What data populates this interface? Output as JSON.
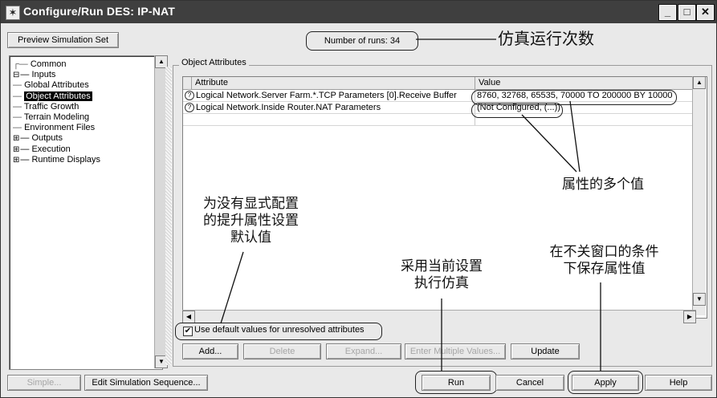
{
  "window": {
    "title": "Configure/Run DES: IP-NAT",
    "icon": "star-app-icon",
    "controls": [
      "minimize-icon",
      "maximize-icon",
      "close-icon"
    ]
  },
  "toolbar": {
    "preview_button": "Preview Simulation Set",
    "runs_label": "Number of runs: 34"
  },
  "tree": {
    "items": [
      {
        "label": "Common",
        "expander": ""
      },
      {
        "label": "Inputs",
        "expander": "⊟"
      },
      {
        "label": "Global Attributes",
        "expander": ""
      },
      {
        "label": "Object Attributes",
        "expander": "",
        "selected": true
      },
      {
        "label": "Traffic Growth",
        "expander": ""
      },
      {
        "label": "Terrain Modeling",
        "expander": ""
      },
      {
        "label": "Environment Files",
        "expander": ""
      },
      {
        "label": "Outputs",
        "expander": "⊞"
      },
      {
        "label": "Execution",
        "expander": "⊞"
      },
      {
        "label": "Runtime Displays",
        "expander": "⊞"
      }
    ]
  },
  "attributes": {
    "group_title": "Object Attributes",
    "columns": [
      "Attribute",
      "Value"
    ],
    "rows": [
      {
        "attribute": "Logical Network.Server Farm.*.TCP Parameters [0].Receive Buffer",
        "value": "8760, 32768, 65535, 70000 TO 200000 BY 10000"
      },
      {
        "attribute": "Logical Network.Inside Router.NAT Parameters",
        "value": "(Not Configured, (...))"
      }
    ],
    "use_default_label": "Use default values for unresolved attributes",
    "use_default_checked": true,
    "buttons": {
      "add": "Add...",
      "delete": "Delete",
      "expand": "Expand...",
      "enter_multiple": "Enter Multiple Values...",
      "update": "Update"
    }
  },
  "bottom": {
    "simple": "Simple...",
    "edit_sequence": "Edit Simulation Sequence...",
    "run": "Run",
    "cancel": "Cancel",
    "apply": "Apply",
    "help": "Help"
  },
  "annotations": {
    "runs": "仿真运行次数",
    "multi_values": "属性的多个值",
    "defaults": [
      "为没有显式配置",
      "的提升属性设置",
      "默认值"
    ],
    "run": [
      "采用当前设置",
      "执行仿真"
    ],
    "apply": [
      "在不关窗口的条件",
      "下保存属性值"
    ]
  }
}
